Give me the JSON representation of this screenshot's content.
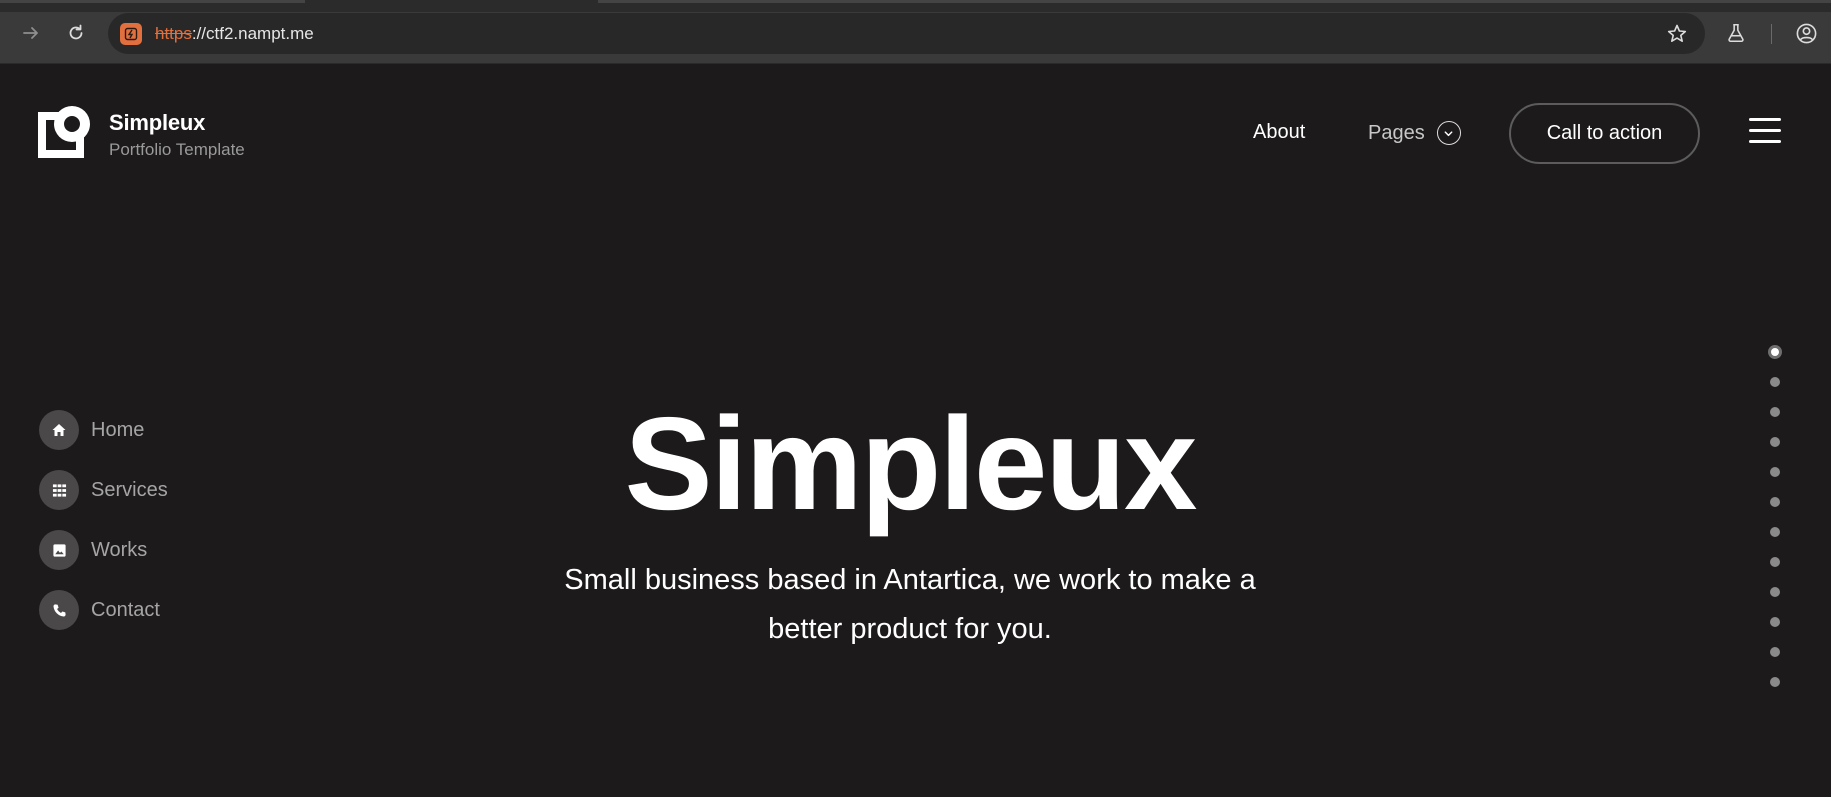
{
  "browser": {
    "url_scheme": "https",
    "url_rest": "://ctf2.nampt.me",
    "icons": [
      "forward-icon",
      "reload-icon",
      "site-insecure-icon",
      "bookmark-star-icon",
      "labs-flask-icon",
      "profile-icon"
    ]
  },
  "brand": {
    "name": "Simpleux",
    "tagline": "Portfolio Template"
  },
  "topnav": {
    "about": "About",
    "pages": "Pages",
    "cta": "Call to action"
  },
  "sidenav": {
    "items": [
      {
        "label": "Home",
        "icon": "home-icon"
      },
      {
        "label": "Services",
        "icon": "grid-icon"
      },
      {
        "label": "Works",
        "icon": "image-icon"
      },
      {
        "label": "Contact",
        "icon": "phone-icon"
      }
    ]
  },
  "hero": {
    "title": "Simpleux",
    "subtitle": "Small business based in Antartica, we work to make a better product for you."
  },
  "pagination": {
    "total": 12,
    "active_index": 0
  },
  "colors": {
    "background": "#1c1a1b",
    "chrome": "#3a3a3a",
    "insecure_accent": "#e2703f",
    "muted_text": "#a5a5a5"
  }
}
